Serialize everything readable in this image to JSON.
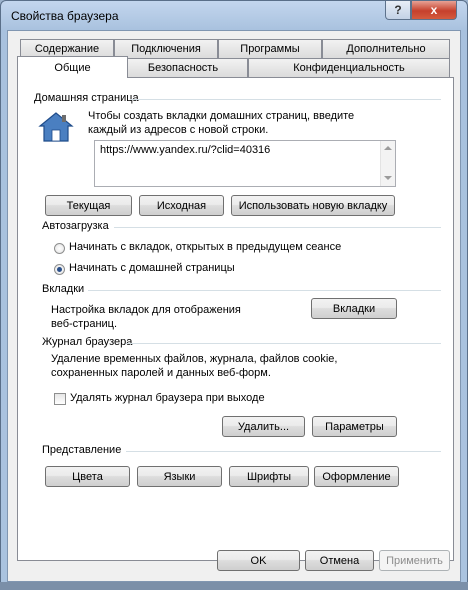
{
  "window": {
    "title": "Свойства браузера",
    "help_label": "?",
    "close_label": "x"
  },
  "tabs": {
    "row1": [
      "Содержание",
      "Подключения",
      "Программы",
      "Дополнительно"
    ],
    "row2": [
      "Общие",
      "Безопасность",
      "Конфиденциальность"
    ],
    "active": "Общие"
  },
  "home": {
    "section": "Домашняя страница",
    "desc_line1": "Чтобы создать вкладки домашних страниц, введите",
    "desc_line2": "каждый из адресов с новой строки.",
    "url": "https://www.yandex.ru/?clid=40316",
    "btn_current": "Текущая",
    "btn_default": "Исходная",
    "btn_newtab": "Использовать новую вкладку"
  },
  "startup": {
    "section": "Автозагрузка",
    "opt1": "Начинать с вкладок, открытых в предыдущем сеансе",
    "opt2": "Начинать с домашней страницы",
    "selected": "opt2"
  },
  "tabs_section": {
    "section": "Вкладки",
    "desc_line1": "Настройка вкладок для отображения",
    "desc_line2": "веб-страниц.",
    "btn": "Вкладки"
  },
  "history": {
    "section": "Журнал браузера",
    "desc_line1": "Удаление временных файлов, журнала, файлов cookie,",
    "desc_line2": "сохраненных паролей и данных веб-форм.",
    "checkbox_label": "Удалять журнал браузера при выходе",
    "checkbox_checked": false,
    "btn_delete": "Удалить...",
    "btn_settings": "Параметры"
  },
  "appearance": {
    "section": "Представление",
    "btn_colors": "Цвета",
    "btn_languages": "Языки",
    "btn_fonts": "Шрифты",
    "btn_accessibility": "Оформление"
  },
  "footer": {
    "ok": "OK",
    "cancel": "Отмена",
    "apply": "Применить"
  }
}
